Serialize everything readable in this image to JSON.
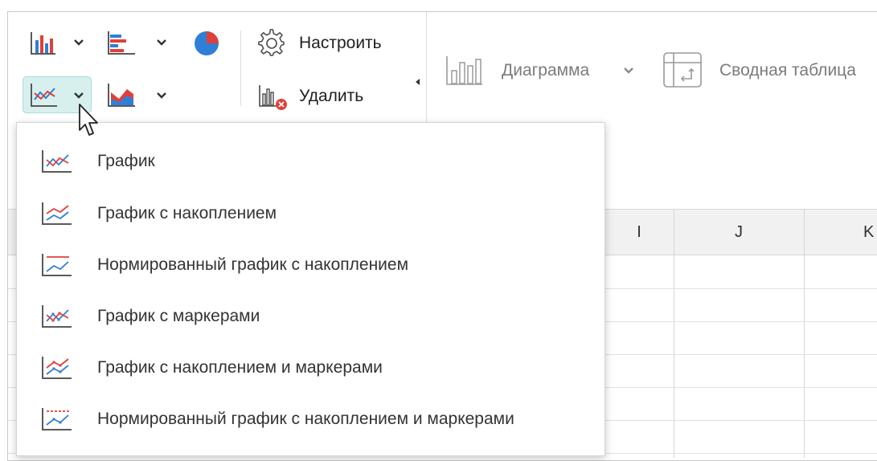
{
  "toolbar": {
    "configure_label": "Настроить",
    "delete_label": "Удалить",
    "chart_label": "Диаграмма",
    "pivot_label": "Сводная таблица"
  },
  "columns": {
    "i": "I",
    "j": "J",
    "k": "K"
  },
  "menu": {
    "items": [
      {
        "label": "График",
        "icon": "line-chart-icon"
      },
      {
        "label": "График с накоплением",
        "icon": "stacked-line-chart-icon"
      },
      {
        "label": "Нормированный график с накоплением",
        "icon": "percent-stacked-line-chart-icon"
      },
      {
        "label": "График с маркерами",
        "icon": "line-markers-chart-icon"
      },
      {
        "label": "График с накоплением и маркерами",
        "icon": "stacked-line-markers-chart-icon"
      },
      {
        "label": "Нормированный график с накоплением и маркерами",
        "icon": "percent-stacked-line-markers-chart-icon"
      }
    ]
  },
  "colors": {
    "accent_blue": "#2f7fd6",
    "accent_red": "#e0403a",
    "highlight": "#d7f0ee"
  }
}
